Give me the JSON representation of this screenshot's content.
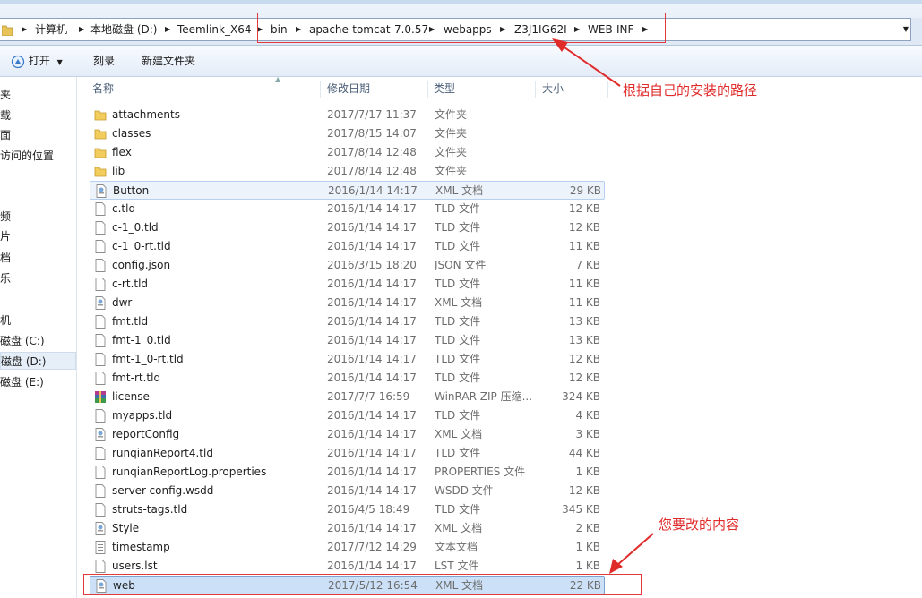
{
  "address": {
    "crumbs": [
      "计算机",
      "本地磁盘 (D:)",
      "Teemlink_X64",
      "bin",
      "apache-tomcat-7.0.57",
      "webapps",
      "Z3J1IG62I",
      "WEB-INF"
    ]
  },
  "toolbar": {
    "open": "打开",
    "burn": "刻录",
    "new_folder": "新建文件夹"
  },
  "nav": {
    "items": [
      "                                        ",
      "访问的位置",
      "机",
      "磁盘 (C:)",
      "磁盘 (D:)",
      "磁盘 (E:)"
    ]
  },
  "columns": {
    "name": "名称",
    "date": "修改日期",
    "type": "类型",
    "size": "大小"
  },
  "files": [
    {
      "name": "attachments",
      "date": "2017/7/17 11:37",
      "type": "文件夹",
      "size": "",
      "icon": "folder"
    },
    {
      "name": "classes",
      "date": "2017/8/15 14:07",
      "type": "文件夹",
      "size": "",
      "icon": "folder"
    },
    {
      "name": "flex",
      "date": "2017/8/14 12:48",
      "type": "文件夹",
      "size": "",
      "icon": "folder"
    },
    {
      "name": "lib",
      "date": "2017/8/14 12:48",
      "type": "文件夹",
      "size": "",
      "icon": "folder"
    },
    {
      "name": "Button",
      "date": "2016/1/14 14:17",
      "type": "XML 文档",
      "size": "29 KB",
      "icon": "xml"
    },
    {
      "name": "c.tld",
      "date": "2016/1/14 14:17",
      "type": "TLD 文件",
      "size": "12 KB",
      "icon": "doc"
    },
    {
      "name": "c-1_0.tld",
      "date": "2016/1/14 14:17",
      "type": "TLD 文件",
      "size": "12 KB",
      "icon": "doc"
    },
    {
      "name": "c-1_0-rt.tld",
      "date": "2016/1/14 14:17",
      "type": "TLD 文件",
      "size": "11 KB",
      "icon": "doc"
    },
    {
      "name": "config.json",
      "date": "2016/3/15 18:20",
      "type": "JSON 文件",
      "size": "7 KB",
      "icon": "doc"
    },
    {
      "name": "c-rt.tld",
      "date": "2016/1/14 14:17",
      "type": "TLD 文件",
      "size": "11 KB",
      "icon": "doc"
    },
    {
      "name": "dwr",
      "date": "2016/1/14 14:17",
      "type": "XML 文档",
      "size": "11 KB",
      "icon": "xml"
    },
    {
      "name": "fmt.tld",
      "date": "2016/1/14 14:17",
      "type": "TLD 文件",
      "size": "13 KB",
      "icon": "doc"
    },
    {
      "name": "fmt-1_0.tld",
      "date": "2016/1/14 14:17",
      "type": "TLD 文件",
      "size": "13 KB",
      "icon": "doc"
    },
    {
      "name": "fmt-1_0-rt.tld",
      "date": "2016/1/14 14:17",
      "type": "TLD 文件",
      "size": "12 KB",
      "icon": "doc"
    },
    {
      "name": "fmt-rt.tld",
      "date": "2016/1/14 14:17",
      "type": "TLD 文件",
      "size": "12 KB",
      "icon": "doc"
    },
    {
      "name": "license",
      "date": "2017/7/7 16:59",
      "type": "WinRAR ZIP 压缩...",
      "size": "324 KB",
      "icon": "zip"
    },
    {
      "name": "myapps.tld",
      "date": "2016/1/14 14:17",
      "type": "TLD 文件",
      "size": "4 KB",
      "icon": "doc"
    },
    {
      "name": "reportConfig",
      "date": "2016/1/14 14:17",
      "type": "XML 文档",
      "size": "3 KB",
      "icon": "xml"
    },
    {
      "name": "runqianReport4.tld",
      "date": "2016/1/14 14:17",
      "type": "TLD 文件",
      "size": "44 KB",
      "icon": "doc"
    },
    {
      "name": "runqianReportLog.properties",
      "date": "2016/1/14 14:17",
      "type": "PROPERTIES 文件",
      "size": "1 KB",
      "icon": "doc"
    },
    {
      "name": "server-config.wsdd",
      "date": "2016/1/14 14:17",
      "type": "WSDD 文件",
      "size": "12 KB",
      "icon": "doc"
    },
    {
      "name": "struts-tags.tld",
      "date": "2016/4/5 18:49",
      "type": "TLD 文件",
      "size": "345 KB",
      "icon": "doc"
    },
    {
      "name": "Style",
      "date": "2016/1/14 14:17",
      "type": "XML 文档",
      "size": "2 KB",
      "icon": "xml"
    },
    {
      "name": "timestamp",
      "date": "2017/7/12 14:29",
      "type": "文本文档",
      "size": "1 KB",
      "icon": "txt"
    },
    {
      "name": "users.lst",
      "date": "2016/1/14 14:17",
      "type": "LST 文件",
      "size": "1 KB",
      "icon": "doc"
    },
    {
      "name": "web",
      "date": "2017/5/12 16:54",
      "type": "XML 文档",
      "size": "22 KB",
      "icon": "xml"
    }
  ],
  "annotations": {
    "path_note": "根据自己的安装的路径",
    "content_note": "您要改的内容"
  },
  "colors": {
    "annotation": "#e02b2b",
    "selection": "#cce0f7"
  }
}
